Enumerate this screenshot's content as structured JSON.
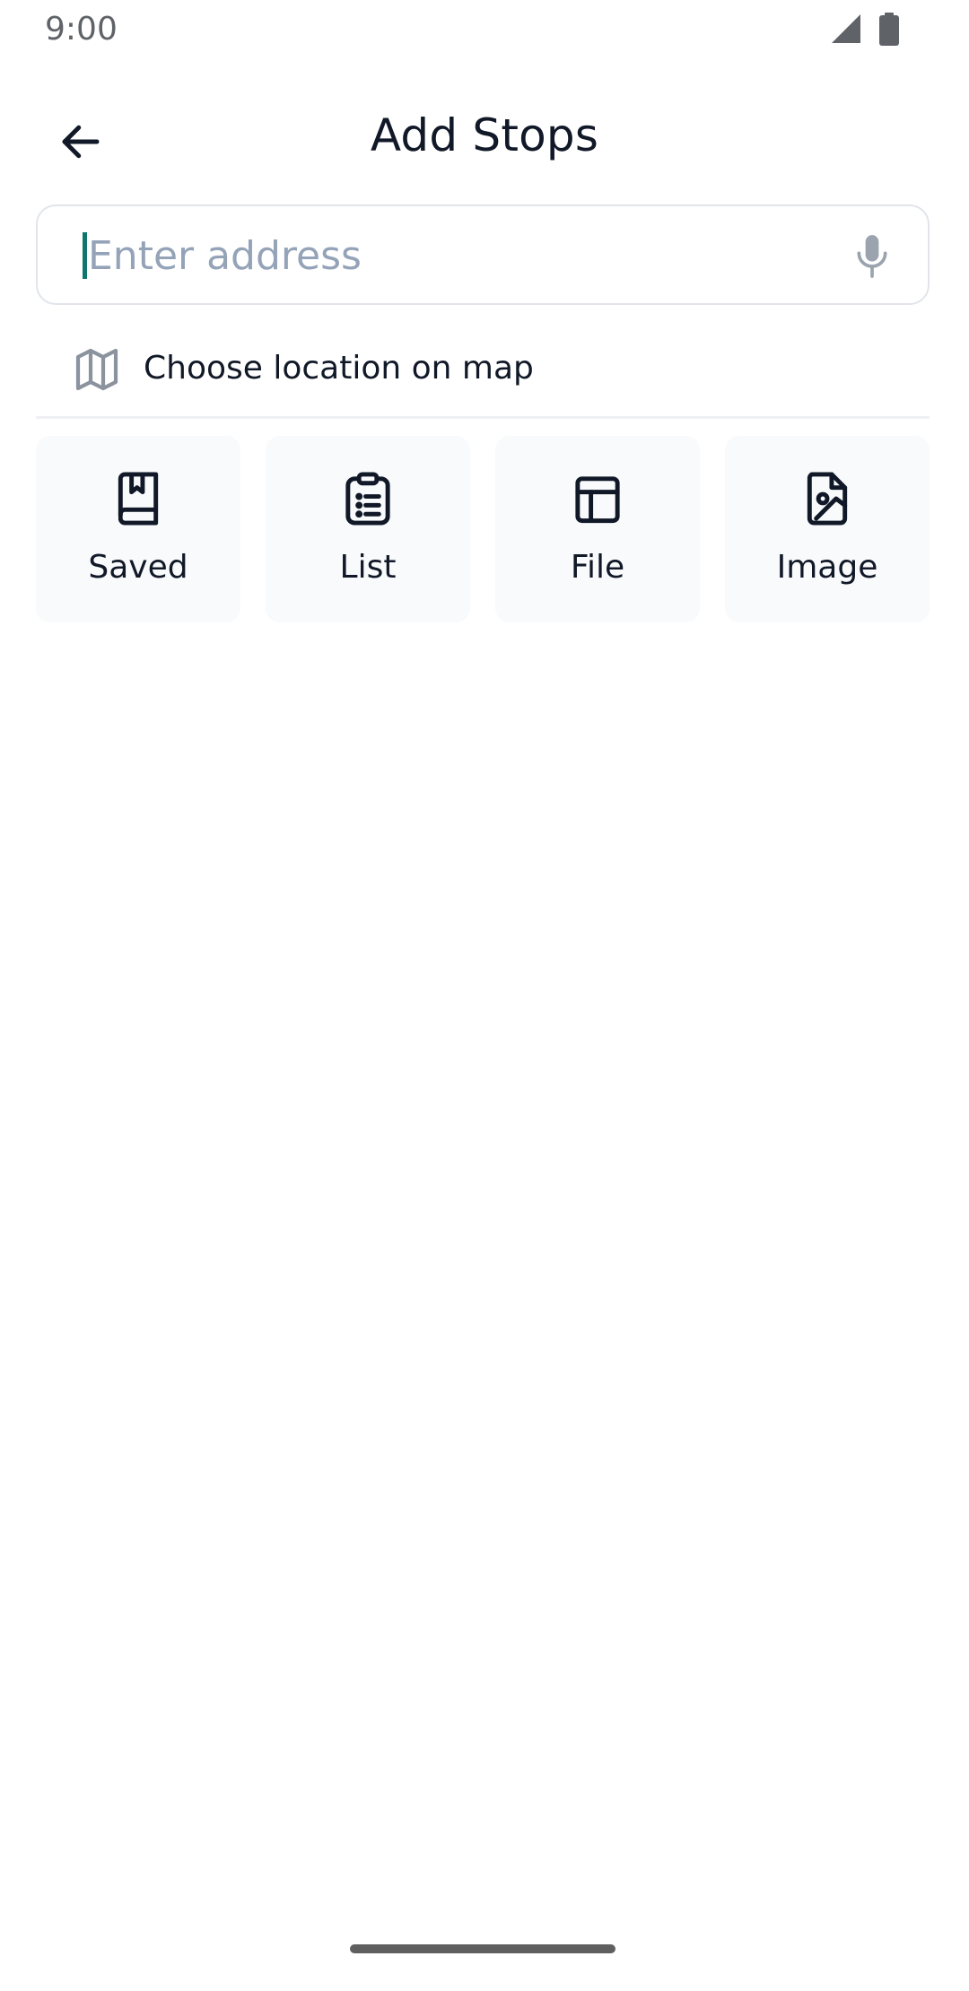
{
  "status_bar": {
    "time": "9:00",
    "icons": [
      "signal-icon",
      "battery-icon"
    ]
  },
  "header": {
    "title": "Add Stops",
    "back_icon": "arrow-left-icon"
  },
  "search": {
    "placeholder": "Enter address",
    "value": "",
    "mic_icon": "microphone-icon"
  },
  "map_option": {
    "label": "Choose location on map",
    "icon": "map-icon"
  },
  "import_options": [
    {
      "label": "Saved",
      "icon": "bookmark-book-icon"
    },
    {
      "label": "List",
      "icon": "clipboard-list-icon"
    },
    {
      "label": "File",
      "icon": "table-file-icon"
    },
    {
      "label": "Image",
      "icon": "image-file-icon"
    }
  ],
  "colors": {
    "accent": "#0f766e",
    "text": "#111827",
    "placeholder": "#94a3b8",
    "card_background": "#f8fafc",
    "border": "#e1e5ea"
  }
}
